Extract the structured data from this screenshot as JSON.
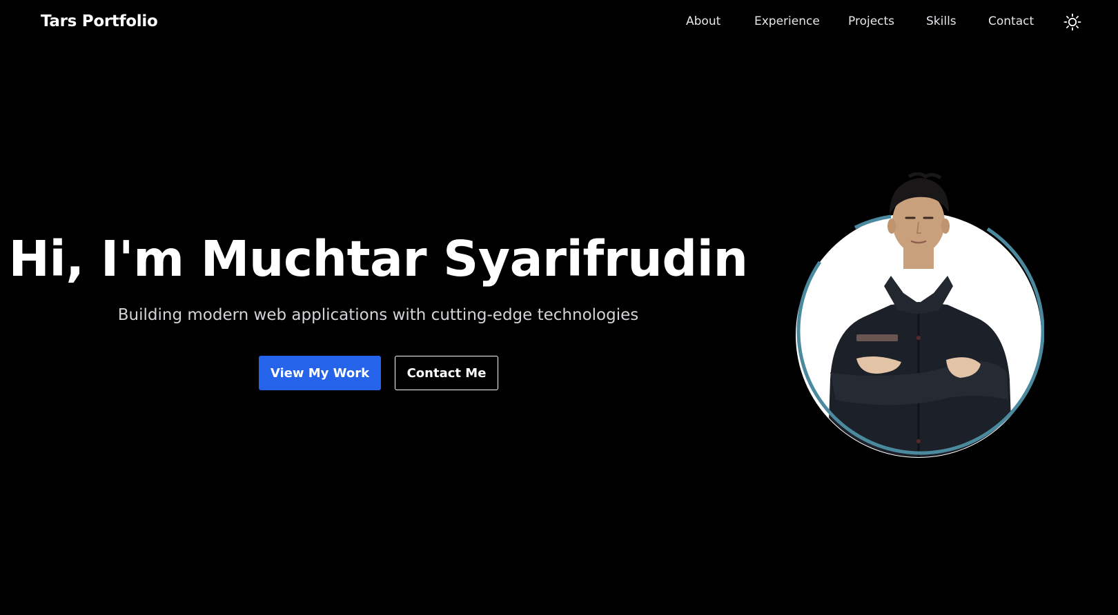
{
  "header": {
    "brand": "Tars Portfolio",
    "nav": [
      {
        "label": "About"
      },
      {
        "label": "Experience"
      },
      {
        "label": "Projects"
      },
      {
        "label": "Skills"
      },
      {
        "label": "Contact"
      }
    ],
    "theme_toggle_icon": "sun-icon"
  },
  "hero": {
    "title": "Hi, I'm Muchtar Syarifrudin",
    "subtitle": "Building modern web applications with cutting-edge technologies",
    "primary_button": "View My Work",
    "secondary_button": "Contact Me",
    "avatar_icon": "profile-photo"
  },
  "colors": {
    "background": "#000000",
    "accent": "#2563eb",
    "avatar_ring": "#4b8a9e",
    "text": "#ffffff"
  }
}
